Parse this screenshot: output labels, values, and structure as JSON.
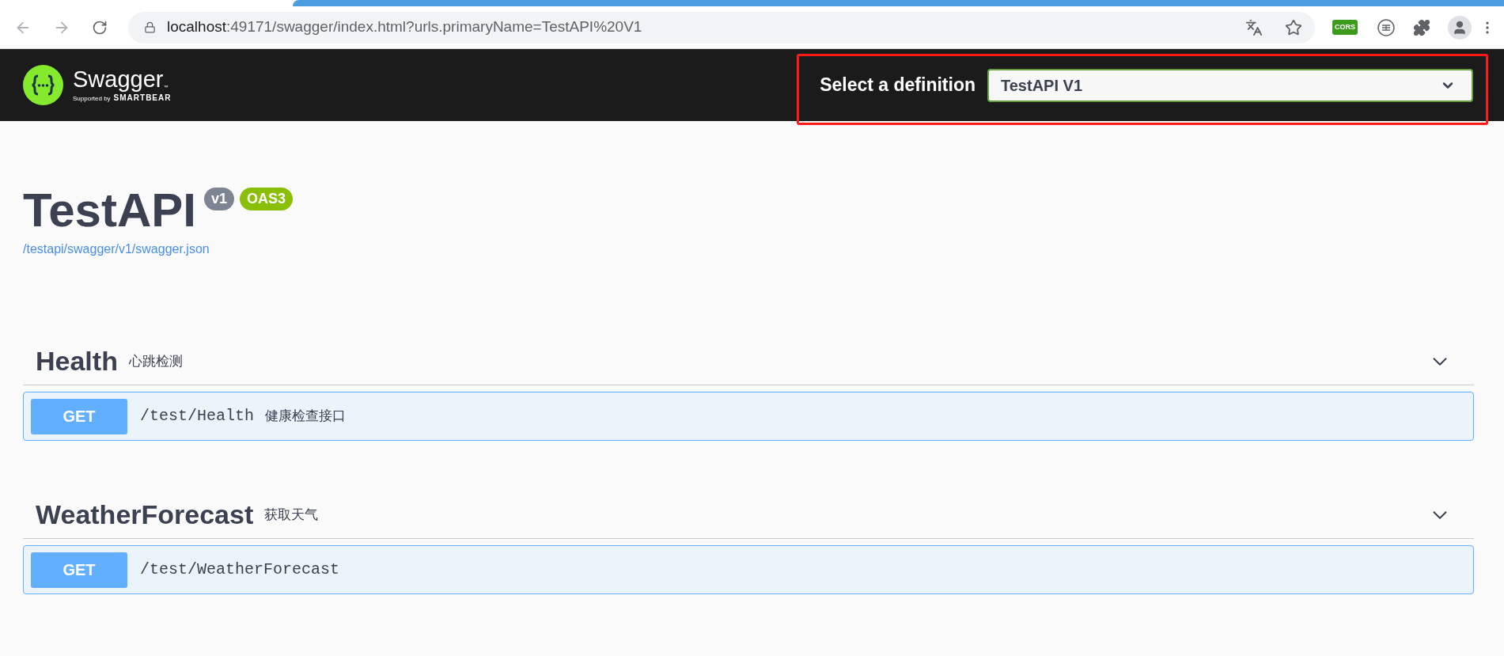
{
  "browser": {
    "url_host": "localhost",
    "url_rest": ":49171/swagger/index.html?urls.primaryName=TestAPI%20V1",
    "extension_label": "CORS"
  },
  "header": {
    "logo_title": "Swagger",
    "logo_trademark": "™",
    "logo_subtitle_prefix": "Supported by",
    "logo_subtitle_brand": "SMARTBEAR",
    "definition_label": "Select a definition",
    "definition_value": "TestAPI V1"
  },
  "info": {
    "title": "TestAPI",
    "version": "v1",
    "spec": "OAS3",
    "spec_url": "/testapi/swagger/v1/swagger.json"
  },
  "tags": [
    {
      "name": "Health",
      "description": "心跳检测",
      "expanded": true,
      "operations": [
        {
          "method": "GET",
          "path": "/test/Health",
          "summary": "健康检查接口"
        }
      ]
    },
    {
      "name": "WeatherForecast",
      "description": "获取天气",
      "expanded": true,
      "operations": [
        {
          "method": "GET",
          "path": "/test/WeatherForecast"
        }
      ]
    }
  ]
}
